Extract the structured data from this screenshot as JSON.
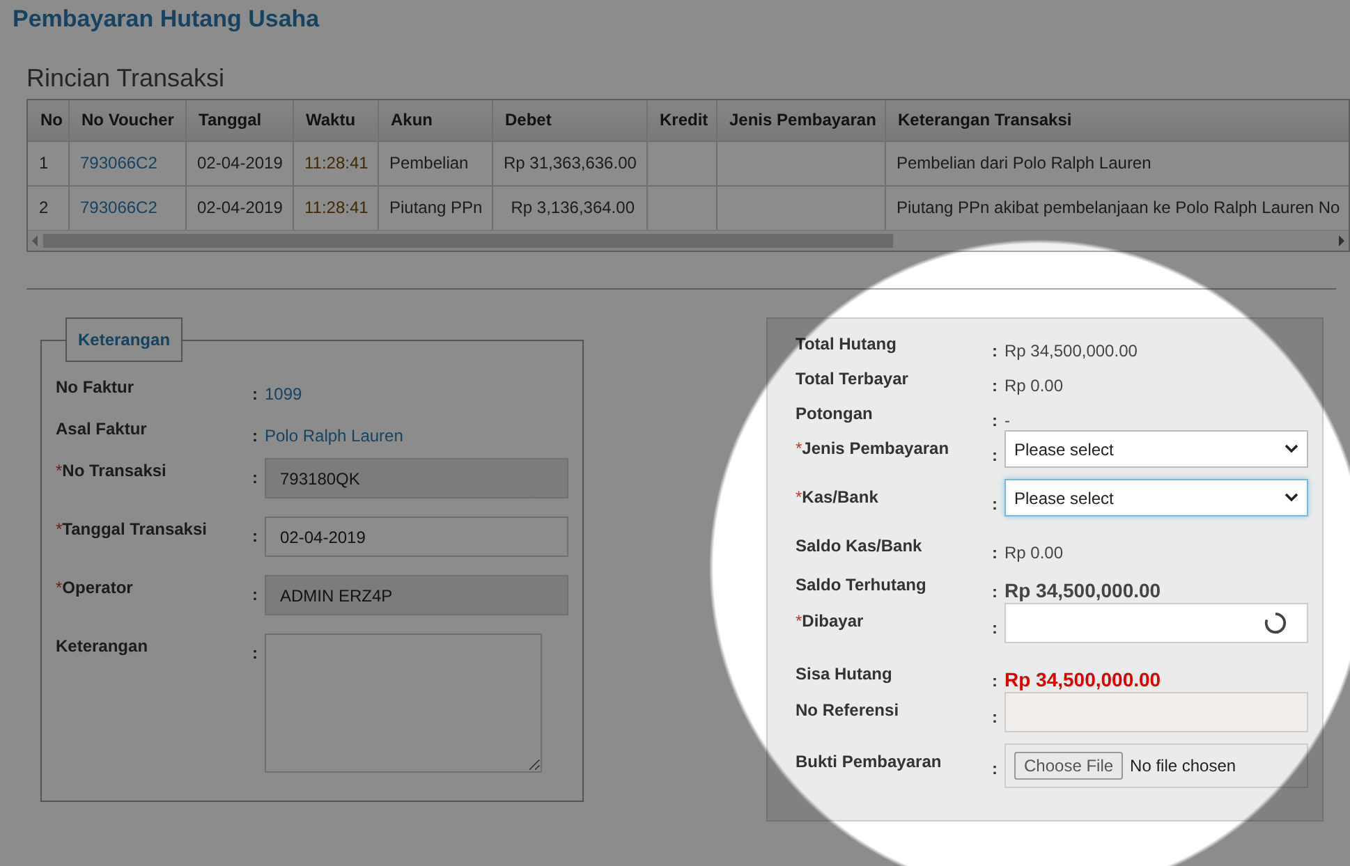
{
  "page_title": "Pembayaran Hutang Usaha",
  "section_title": "Rincian Transaksi",
  "table": {
    "columns": [
      {
        "label": "No",
        "kind": "text"
      },
      {
        "label": "No Voucher",
        "kind": "link"
      },
      {
        "label": "Tanggal",
        "kind": "text"
      },
      {
        "label": "Waktu",
        "kind": "time"
      },
      {
        "label": "Akun",
        "kind": "text"
      },
      {
        "label": "Debet",
        "kind": "money"
      },
      {
        "label": "Kredit",
        "kind": "money"
      },
      {
        "label": "Jenis Pembayaran",
        "kind": "text"
      },
      {
        "label": "Keterangan Transaksi",
        "kind": "text"
      }
    ],
    "rows": [
      [
        "1",
        "793066C2",
        "02-04-2019",
        "11:28:41",
        "Pembelian",
        "Rp 31,363,636.00",
        "",
        "",
        "Pembelian dari Polo Ralph Lauren"
      ],
      [
        "2",
        "793066C2",
        "02-04-2019",
        "11:28:41",
        "Piutang PPn",
        "Rp 3,136,364.00",
        "",
        "",
        "Piutang PPn akibat pembelanjaan ke Polo Ralph Lauren No"
      ]
    ]
  },
  "info_box": {
    "legend": "Keterangan",
    "fields": [
      {
        "label": "No Faktur",
        "colon": ":",
        "kind": "link",
        "value": "1099"
      },
      {
        "label": "Asal Faktur",
        "colon": ":",
        "kind": "link",
        "value": "Polo Ralph Lauren"
      },
      {
        "required_mark": "*",
        "label": "No Transaksi",
        "colon": ":",
        "kind": "input",
        "readonly": true,
        "value": "793180QK"
      },
      {
        "required_mark": "*",
        "label": "Tanggal Transaksi",
        "colon": ":",
        "kind": "input",
        "readonly": false,
        "value": "02-04-2019"
      },
      {
        "required_mark": "*",
        "label": "Operator",
        "colon": ":",
        "kind": "input",
        "readonly": true,
        "value": "ADMIN ERZ4P"
      },
      {
        "label": "Keterangan",
        "colon": ":",
        "kind": "textarea"
      }
    ]
  },
  "payment_panel": {
    "fields": [
      {
        "label": "Total Hutang",
        "colon": ":",
        "kind": "text",
        "strong": false,
        "alert": false,
        "value": "Rp 34,500,000.00"
      },
      {
        "label": "Total Terbayar",
        "colon": ":",
        "kind": "text",
        "strong": false,
        "alert": false,
        "value": "Rp 0.00"
      },
      {
        "label": "Potongan",
        "colon": ":",
        "kind": "text",
        "strong": false,
        "alert": false,
        "value": "-"
      },
      {
        "required_mark": "*",
        "label": "Jenis Pembayaran",
        "colon": ":",
        "kind": "select",
        "focused": false,
        "value": "Please select"
      },
      {
        "required_mark": "*",
        "label": "Kas/Bank",
        "colon": ":",
        "kind": "select",
        "focused": true,
        "value": "Please select"
      },
      {
        "label": "Saldo Kas/Bank",
        "colon": ":",
        "kind": "text",
        "strong": false,
        "alert": false,
        "value": "Rp 0.00"
      },
      {
        "label": "Saldo Terhutang",
        "colon": ":",
        "kind": "text",
        "strong": true,
        "alert": false,
        "value": "Rp 34,500,000.00"
      },
      {
        "required_mark": "*",
        "label": "Dibayar",
        "colon": ":",
        "kind": "loading-input"
      },
      {
        "label": "Sisa Hutang",
        "colon": ":",
        "kind": "text",
        "strong": true,
        "alert": true,
        "value": "Rp 34,500,000.00"
      },
      {
        "label": "No Referensi",
        "colon": ":",
        "kind": "input",
        "readonly": true
      },
      {
        "label": "Bukti Pembayaran",
        "colon": ":",
        "kind": "file",
        "button": "Choose File",
        "status": "No file chosen"
      }
    ]
  }
}
